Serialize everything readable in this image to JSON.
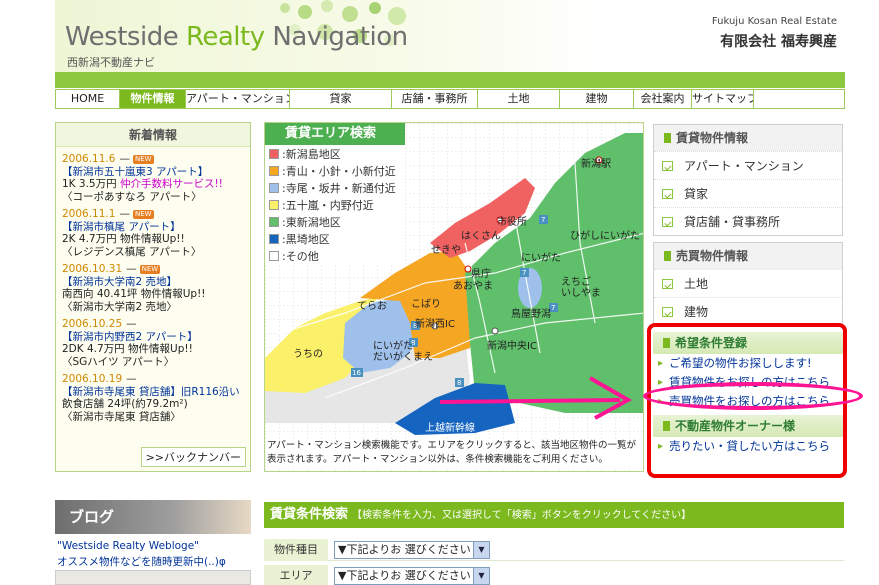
{
  "header": {
    "brand_part1": "Westside ",
    "brand_part2": "Realty",
    "brand_part3": " Navigation",
    "subtitle": "西新潟不動産ナビ",
    "company_en": "Fukuju Kosan Real Estate",
    "company_jp": "有限会社 福寿興産"
  },
  "nav": [
    {
      "label": "HOME",
      "active": false
    },
    {
      "label": "物件情報",
      "active": true
    },
    {
      "label": "アパート・マンション",
      "active": false
    },
    {
      "label": "貸家",
      "active": false
    },
    {
      "label": "店舗・事務所",
      "active": false
    },
    {
      "label": "土地",
      "active": false
    },
    {
      "label": "建物",
      "active": false
    },
    {
      "label": "会社案内",
      "active": false
    },
    {
      "label": "サイトマップ",
      "active": false
    }
  ],
  "news": {
    "heading": "新着情報",
    "new_badge": "NEW",
    "items": [
      {
        "date": "2006.11.6",
        "new": true,
        "title": "【新潟市五十嵐東3 アパート】",
        "line1": "1K 3.5万円 ",
        "highlight": "仲介手数料サービス!!",
        "line2": "〈コーポあすなろ アパート〉"
      },
      {
        "date": "2006.11.1",
        "new": true,
        "title": "【新潟市槙尾 アパート】",
        "line1": "2K 4.7万円 物件情報Up!!",
        "highlight": "",
        "line2": "〈レジデンス槙尾 アパート〉"
      },
      {
        "date": "2006.10.31",
        "new": true,
        "title": "【新潟市大学南2 売地】",
        "line1": "南西向 40.41坪 物件情報Up!!",
        "highlight": "",
        "line2": "〈新潟市大学南2 売地〉"
      },
      {
        "date": "2006.10.25",
        "new": false,
        "title": "【新潟市内野西2 アパート】",
        "line1": "2DK 4.7万円 物件情報Up!!",
        "highlight": "",
        "line2": "〈SGハイツ アパート〉"
      },
      {
        "date": "2006.10.19",
        "new": false,
        "title": "【新潟市寺尾東 貸店舗】旧R116沿い",
        "line1": "飲食店舗 24坪(約79.2m²)",
        "highlight": "",
        "line2": "〈新潟市寺尾東 貸店舗〉"
      }
    ],
    "backnumber": ">>バックナンバー"
  },
  "map": {
    "heading": "賃貸エリア検索",
    "legend": [
      {
        "label": ":新潟島地区",
        "color": "#f06262"
      },
      {
        "label": ":青山・小針・小新付近",
        "color": "#f5a623"
      },
      {
        "label": ":寺尾・坂井・新通付近",
        "color": "#9ec0ea"
      },
      {
        "label": ":五十嵐・内野付近",
        "color": "#fbf06a"
      },
      {
        "label": ":東新潟地区",
        "color": "#5fbf6b"
      },
      {
        "label": ":黒埼地区",
        "color": "#1565c0"
      },
      {
        "label": ":その他",
        "color": "#ffffff"
      }
    ],
    "labels": {
      "niigata_eki": "新潟駅",
      "shiyakusho": "市役所",
      "hakusan": "はくさん",
      "sekiya": "せきや",
      "kencho": "県庁",
      "niigata": "にいがた",
      "higashi": "ひがしにいがた",
      "aoyama": "あおやま",
      "echigo": "えちご\nいしやま",
      "toya": "鳥屋野潟",
      "teraoi": "てらお",
      "kobari": "こばり",
      "nishi_ic": "新潟西IC",
      "chuo_ic": "新潟中央IC",
      "uchino": "うちの",
      "daigakumae": "にいがた\nだいがくまえ",
      "joetsu": "上越新幹線"
    },
    "route_numbers": [
      "7",
      "7",
      "7",
      "8",
      "8",
      "8",
      "16"
    ],
    "note": "アパート・マンション検索機能です。エリアをクリックすると、該当地区物件の一覧が表示されます。アパート・マンション以外は、条件検索機能をご利用ください。"
  },
  "right": {
    "rent_heading": "賃貸物件情報",
    "rent_links": [
      "アパート・マンション",
      "貸家",
      "貸店舗・貸事務所"
    ],
    "sale_heading": "売買物件情報",
    "sale_links": [
      "土地",
      "建物"
    ],
    "cond_heading": "希望条件登録",
    "cond_links": [
      "ご希望の物件お探しします!",
      "賃貸物件をお探しの方はこちら",
      "売買物件をお探しの方はこちら"
    ],
    "owner_heading": "不動産物件オーナー様",
    "owner_link": "売りたい・貸したい方はこちら"
  },
  "blog": {
    "heading": "ブログ",
    "desc1": "\"Westside Realty Webloge\"",
    "desc2": "オススメ物件などを随時更新中(..)φ"
  },
  "search": {
    "heading": "賃貸条件検索",
    "hint": "【検索条件を入力、又は選択して「検索」ボタンをクリックしてください】",
    "rows": [
      {
        "label": "物件種目",
        "value": "▼下記よりお 選びください"
      },
      {
        "label": "エリア",
        "value": "▼下記よりお 選びください"
      }
    ]
  },
  "colors": {
    "brand_green": "#7cb91e",
    "annotation_red": "#ee0000",
    "annotation_pink": "#ff1493"
  }
}
